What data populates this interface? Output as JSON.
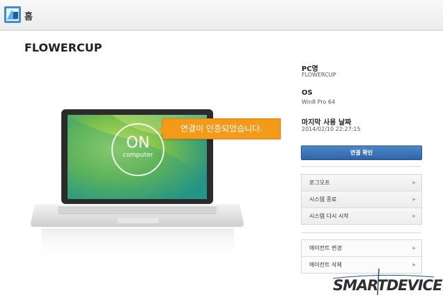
{
  "header": {
    "title": "홈"
  },
  "device": {
    "name": "FLOWERCUP"
  },
  "screen": {
    "line1": "ON",
    "line2": "computer"
  },
  "tooltip": {
    "text": "연결이 인증되었습니다."
  },
  "info": {
    "pc_label": "PC명",
    "pc_value": "FLOWERCUP",
    "os_label": "OS",
    "os_value": "Win8 Pro 64",
    "last_label": "마지막 사용 날짜",
    "last_value": "2014/02/10 22:27:15"
  },
  "actions": {
    "connect_check": "연결 확인"
  },
  "power_menu": [
    {
      "label": "로그오프"
    },
    {
      "label": "시스템 종료"
    },
    {
      "label": "시스템 다시 시작"
    }
  ],
  "agent_menu": [
    {
      "label": "에이전트 변경"
    },
    {
      "label": "에이전트 삭제"
    }
  ],
  "brand": {
    "text": "SMARTDEVICE"
  },
  "colors": {
    "accent": "#f39a1a",
    "primary_button": "#2d66a8",
    "screen_green": "#7cc04a"
  }
}
